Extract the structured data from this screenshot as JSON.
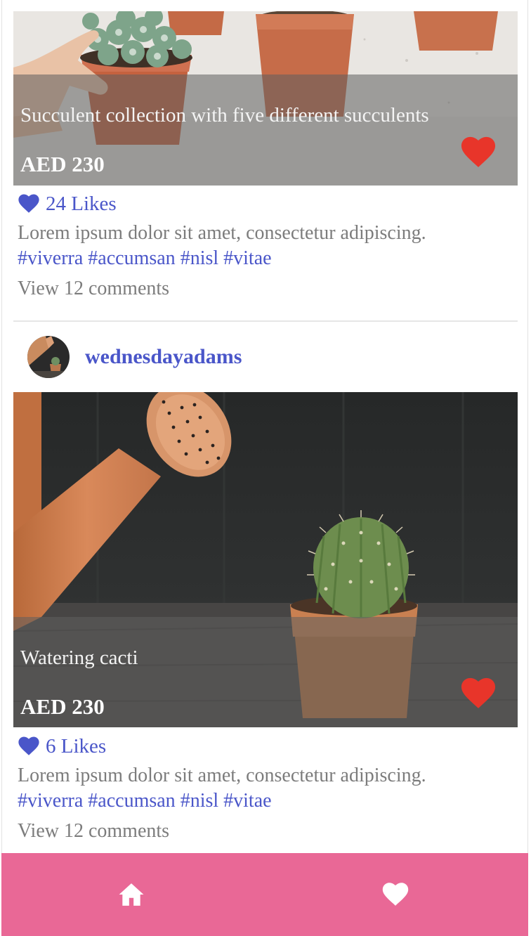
{
  "posts": [
    {
      "title": "Succulent collection with five different succulents",
      "price": "AED 230",
      "likes": "24 Likes",
      "description": "Lorem ipsum dolor sit amet, consectetur adipiscing.",
      "tags": [
        "#viverra",
        "#accumsan",
        "#nisl",
        "#vitae"
      ],
      "comments": "View 12 comments",
      "favorited": true
    },
    {
      "username": "wednesdayadams",
      "title": "Watering cacti",
      "price": "AED 230",
      "likes": "6 Likes",
      "description": "Lorem ipsum dolor sit amet, consectetur adipiscing.",
      "tags": [
        "#viverra",
        "#accumsan",
        "#nisl",
        "#vitae"
      ],
      "comments": "View 12 comments",
      "favorited": true
    }
  ],
  "tab_bar": {
    "items": [
      {
        "icon": "home-icon"
      },
      {
        "icon": "heart-icon"
      }
    ]
  },
  "colors": {
    "accent": "#4a56c9",
    "favorite": "#e8352a",
    "tab_bar": "#e96896",
    "muted_text": "#7c7c7c"
  }
}
